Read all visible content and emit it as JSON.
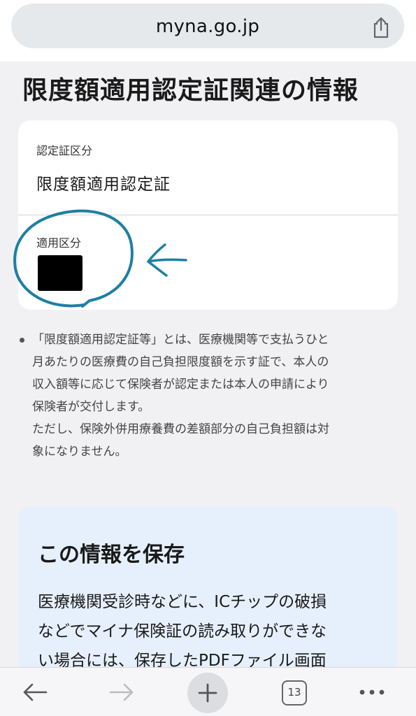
{
  "browser": {
    "url": "myna.go.jp",
    "tab_count": "13"
  },
  "page": {
    "title": "限度額適用認定証関連の情報"
  },
  "card": {
    "fields": [
      {
        "label": "認定証区分",
        "value": "限度額適用認定証"
      },
      {
        "label": "適用区分",
        "value": ""
      }
    ]
  },
  "note": {
    "text": "「限度額適用認定証等」とは、医療機関等で支払うひと\n月あたりの医療費の自己負担限度額を示す証で、本人の\n収入額等に応じて保険者が認定または本人の申請により\n保険者が交付します。\nただし、保険外併用療養費の差額部分の自己負担額は対\n象になりません。"
  },
  "save_section": {
    "title": "この情報を保存",
    "body": "医療機関受診時などに、ICチップの破損\nなどでマイナ保険証の読み取りができな\nい場合には、保存したPDFファイル画面"
  },
  "colors": {
    "annotation": "#1e7fa3",
    "save_card_bg": "#e6f0fd"
  }
}
